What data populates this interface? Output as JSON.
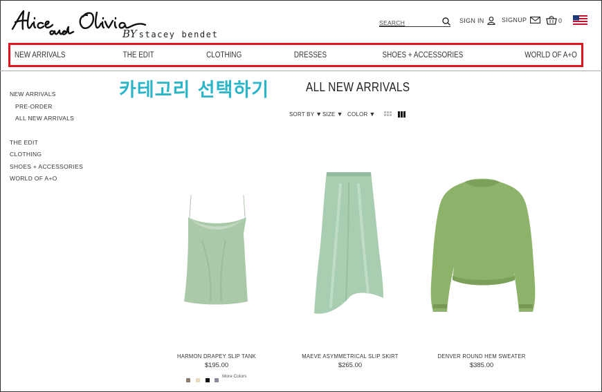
{
  "brand": {
    "logo_text": "Alice and Olivia",
    "by": "BY",
    "designer": "stacey bendet"
  },
  "header": {
    "search_placeholder": "SEARCH",
    "sign_in": "SIGN IN",
    "signup": "SIGNUP",
    "cart_count": "0"
  },
  "nav": [
    "NEW ARRIVALS",
    "THE EDIT",
    "CLOTHING",
    "DRESSES",
    "SHOES + ACCESSORIES",
    "WORLD OF A+O"
  ],
  "annotation": "카테고리 선택하기",
  "page_title": "ALL NEW ARRIVALS",
  "sidebar": {
    "new_arrivals": "NEW ARRIVALS",
    "sub": [
      "PRE-ORDER",
      "ALL NEW ARRIVALS"
    ],
    "links": [
      "THE EDIT",
      "CLOTHING",
      "SHOES + ACCESSORIES",
      "WORLD OF A+O"
    ]
  },
  "filters": {
    "sort_by": "SORT BY",
    "size": "SIZE",
    "color": "COLOR"
  },
  "products": [
    {
      "name": "HARMON DRAPEY SLIP TANK",
      "price": "$195.00"
    },
    {
      "name": "MAEVE ASYMMETRICAL SLIP SKIRT",
      "price": "$265.00"
    },
    {
      "name": "DENVER ROUND HEM SWEATER",
      "price": "$385.00"
    }
  ],
  "swatches": [
    "#8c7a6b",
    "#e8d8c0",
    "#111111",
    "#8a8a9a"
  ],
  "more_colors": "More Colors",
  "colors": {
    "nav_highlight": "#e0141b",
    "annotation": "#2bb5c8",
    "product_mint": "#a9c9a8",
    "product_sage": "#8db36a"
  },
  "icons": {
    "search": "search-icon",
    "user": "user-icon",
    "mail": "mail-icon",
    "cart": "cart-icon",
    "flag": "us-flag-icon"
  }
}
